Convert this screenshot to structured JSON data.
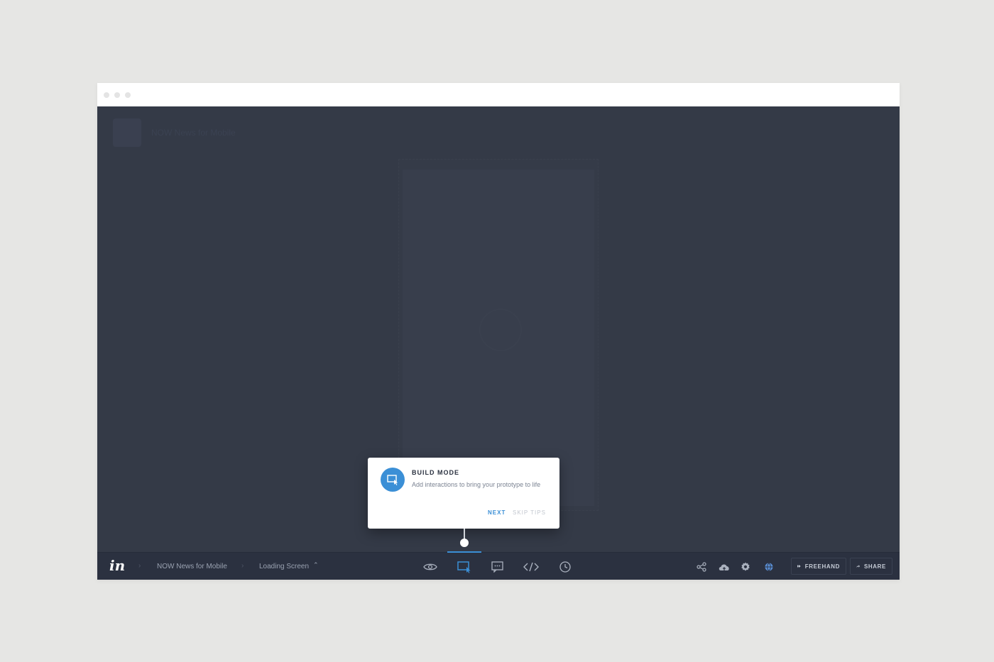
{
  "background_color": "#e6e6e4",
  "canvas": {
    "ghost_project_name": "NOW News for Mobile"
  },
  "tip": {
    "title": "BUILD MODE",
    "body": "Add interactions to bring your prototype to life",
    "next_label": "NEXT",
    "skip_label": "SKIP TIPS",
    "accent_color": "#3b8fd6"
  },
  "toolbar": {
    "logo": "in",
    "breadcrumb": {
      "project": "NOW News for Mobile",
      "screen": "Loading Screen",
      "caret": "⌃"
    },
    "modes": [
      {
        "name": "preview-mode-button",
        "icon": "eye-icon",
        "active": false
      },
      {
        "name": "build-mode-button",
        "icon": "build-cursor-icon",
        "active": true
      },
      {
        "name": "comment-mode-button",
        "icon": "comment-icon",
        "active": false
      },
      {
        "name": "inspect-mode-button",
        "icon": "code-icon",
        "active": false
      },
      {
        "name": "history-mode-button",
        "icon": "clock-icon",
        "active": false
      }
    ],
    "right_icons": [
      "share-network-icon",
      "cloud-sync-icon",
      "gear-icon",
      "globe-icon"
    ],
    "freehand_label": "FREEHAND",
    "share_label": "SHARE"
  }
}
